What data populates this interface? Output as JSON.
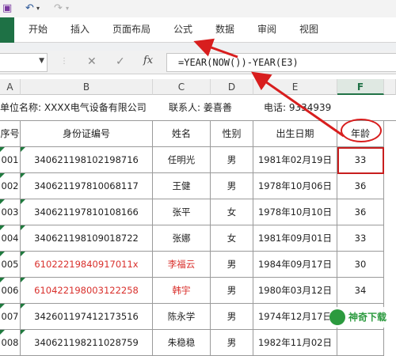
{
  "quick_access": {
    "icons": [
      "save-icon",
      "undo-icon",
      "undo-dropdown-icon",
      "redo-icon",
      "redo-dropdown-icon"
    ]
  },
  "ribbon": {
    "tabs": [
      {
        "label": "开始"
      },
      {
        "label": "插入"
      },
      {
        "label": "页面布局"
      },
      {
        "label": "公式"
      },
      {
        "label": "数据"
      },
      {
        "label": "审阅"
      },
      {
        "label": "视图"
      }
    ],
    "file_color": "#1e7145"
  },
  "formula_bar": {
    "formula": "=YEAR(NOW())-YEAR(E3)",
    "cancel_icon": "close-icon",
    "enter_icon": "check-icon",
    "fx_label": "fx"
  },
  "columns": [
    {
      "label": "A"
    },
    {
      "label": "B"
    },
    {
      "label": "C"
    },
    {
      "label": "D"
    },
    {
      "label": "E"
    },
    {
      "label": "F"
    }
  ],
  "sheet": {
    "info": {
      "unit": "单位名称: XXXX电气设备有限公司",
      "contact": "联系人: 姜喜善",
      "phone": "电话: 9334939"
    },
    "headers": [
      "序号",
      "身份证编号",
      "姓名",
      "性别",
      "出生日期",
      "年龄"
    ],
    "rows": [
      {
        "no": "001",
        "id": "340621198102198716",
        "name": "任明光",
        "gender": "男",
        "birth": "1981年02月19日",
        "age": "33",
        "red": false
      },
      {
        "no": "002",
        "id": "340621197810068117",
        "name": "王健",
        "gender": "男",
        "birth": "1978年10月06日",
        "age": "36",
        "red": false
      },
      {
        "no": "003",
        "id": "340621197810108166",
        "name": "张平",
        "gender": "女",
        "birth": "1978年10月10日",
        "age": "36",
        "red": false
      },
      {
        "no": "004",
        "id": "340621198109018722",
        "name": "张娜",
        "gender": "女",
        "birth": "1981年09月01日",
        "age": "33",
        "red": false
      },
      {
        "no": "005",
        "id": "61022219840917011x",
        "name": "李福云",
        "gender": "男",
        "birth": "1984年09月17日",
        "age": "30",
        "red": true
      },
      {
        "no": "006",
        "id": "610422198003122258",
        "name": "韩宇",
        "gender": "男",
        "birth": "1980年03月12日",
        "age": "34",
        "red": true
      },
      {
        "no": "007",
        "id": "342601197412173516",
        "name": "陈永学",
        "gender": "男",
        "birth": "1974年12月17日",
        "age": "",
        "red": false
      },
      {
        "no": "008",
        "id": "340621198211028759",
        "name": "朱稳稳",
        "gender": "男",
        "birth": "1982年11月02日",
        "age": "",
        "red": false
      }
    ]
  },
  "annotation_color": "#d81e1e",
  "watermark": {
    "text": "神奇下载"
  }
}
